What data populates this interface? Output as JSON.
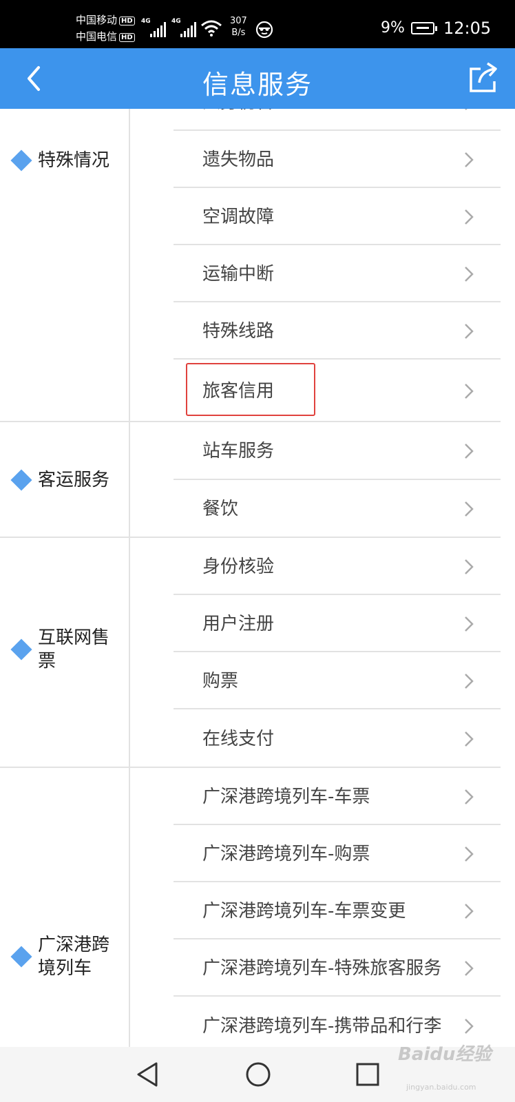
{
  "status_bar": {
    "carrier1": "中国移动",
    "carrier2": "中国电信",
    "hd_badge": "HD",
    "network1": "4G",
    "network2": "4G",
    "net_speed_value": "307",
    "net_speed_unit": "B/s",
    "battery": "9%",
    "time": "12:05"
  },
  "header": {
    "title": "信息服务"
  },
  "sections": [
    {
      "category": "特殊情况",
      "items": [
        "人身伤害",
        "遗失物品",
        "空调故障",
        "运输中断",
        "特殊线路",
        "旅客信用"
      ]
    },
    {
      "category": "客运服务",
      "items": [
        "站车服务",
        "餐饮"
      ]
    },
    {
      "category": "互联网售票",
      "items": [
        "身份核验",
        "用户注册",
        "购票",
        "在线支付"
      ]
    },
    {
      "category": "广深港跨境列车",
      "items": [
        "广深港跨境列车-车票",
        "广深港跨境列车-购票",
        "广深港跨境列车-车票变更",
        "广深港跨境列车-特殊旅客服务",
        "广深港跨境列车-携带品和行李"
      ]
    }
  ],
  "watermark": {
    "brand": "Baidu经验",
    "url": "jingyan.baidu.com"
  }
}
